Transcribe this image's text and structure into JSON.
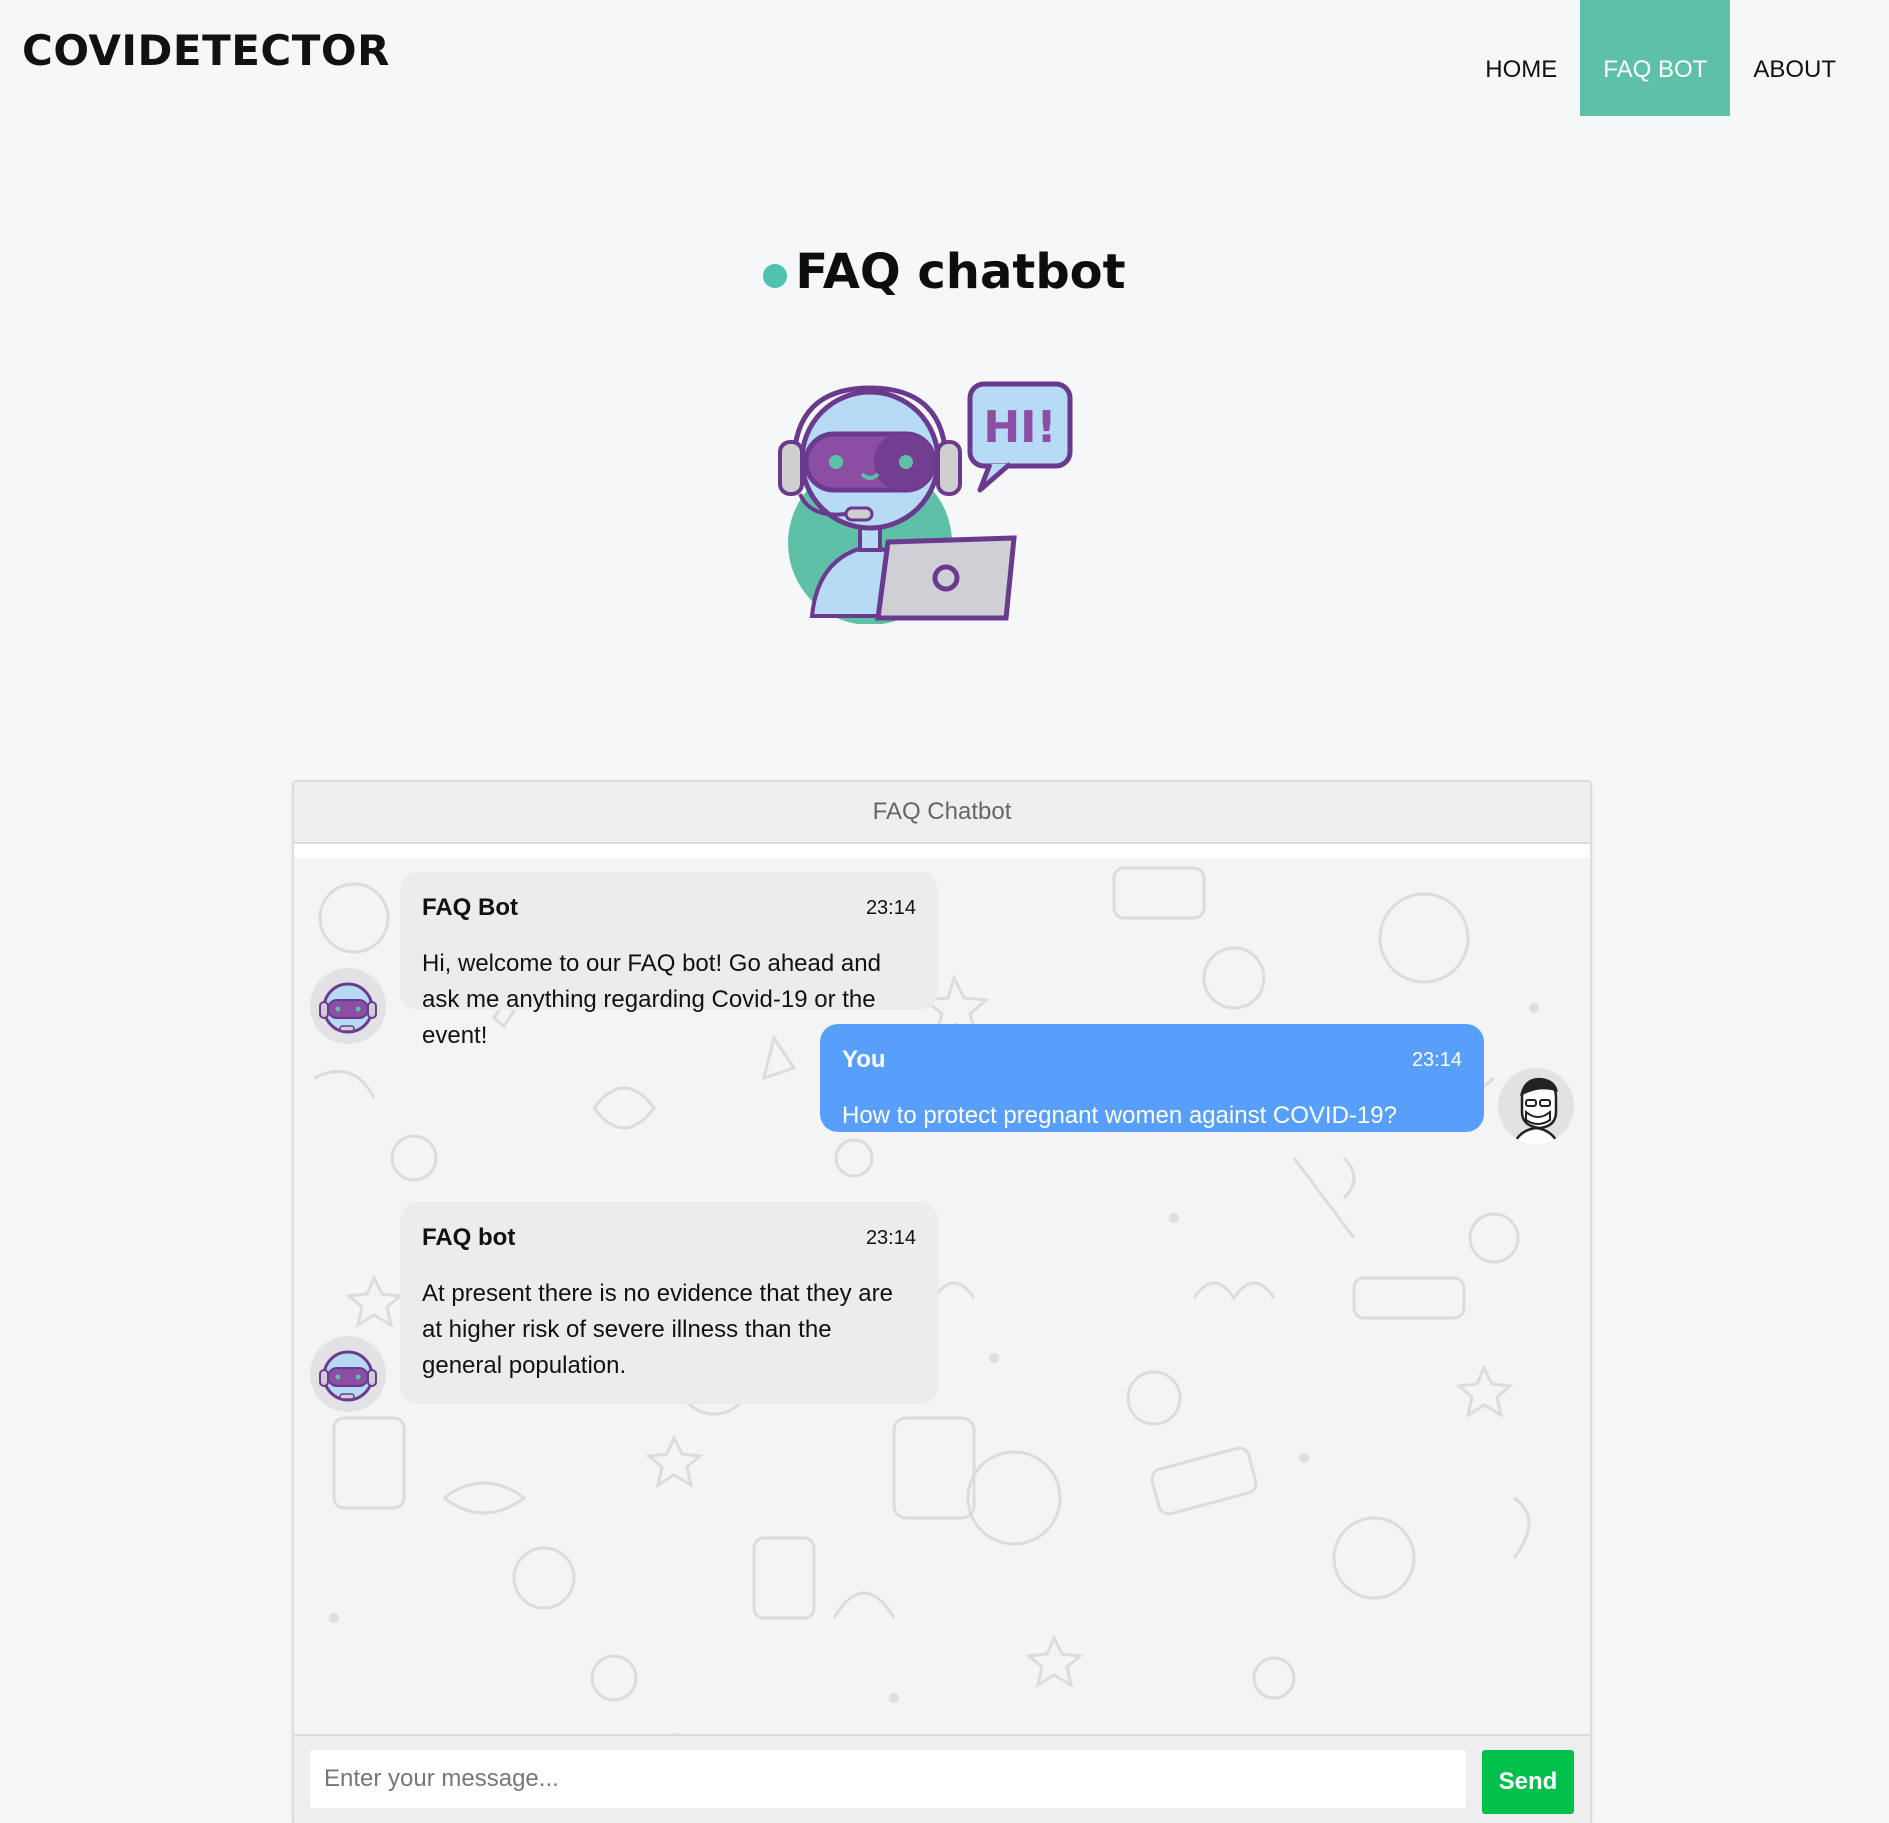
{
  "header": {
    "brand": "COVIDETECTOR",
    "nav": [
      {
        "label": "HOME",
        "active": false
      },
      {
        "label": "FAQ BOT",
        "active": true
      },
      {
        "label": "ABOUT",
        "active": false
      }
    ]
  },
  "page": {
    "title": "FAQ chatbot",
    "hero_bubble_text": "HI!"
  },
  "chat": {
    "header_title": "FAQ Chatbot",
    "messages": [
      {
        "sender": "FAQ Bot",
        "time": "23:14",
        "text": "Hi, welcome to our FAQ bot! Go ahead and ask me anything regarding Covid-19 or the event!",
        "side": "left"
      },
      {
        "sender": "You",
        "time": "23:14",
        "text": "How to protect pregnant women against COVID-19?",
        "side": "right"
      },
      {
        "sender": "FAQ bot",
        "time": "23:14",
        "text": "At present there is no evidence that they are at higher risk of severe illness than the general population.",
        "side": "left"
      }
    ],
    "input": {
      "placeholder": "Enter your message...",
      "value": ""
    },
    "send_label": "Send"
  },
  "colors": {
    "accent": "#5ec0a7",
    "user_bubble": "#579ffb",
    "bot_bubble": "#ececec",
    "send_button": "#00c04b"
  }
}
